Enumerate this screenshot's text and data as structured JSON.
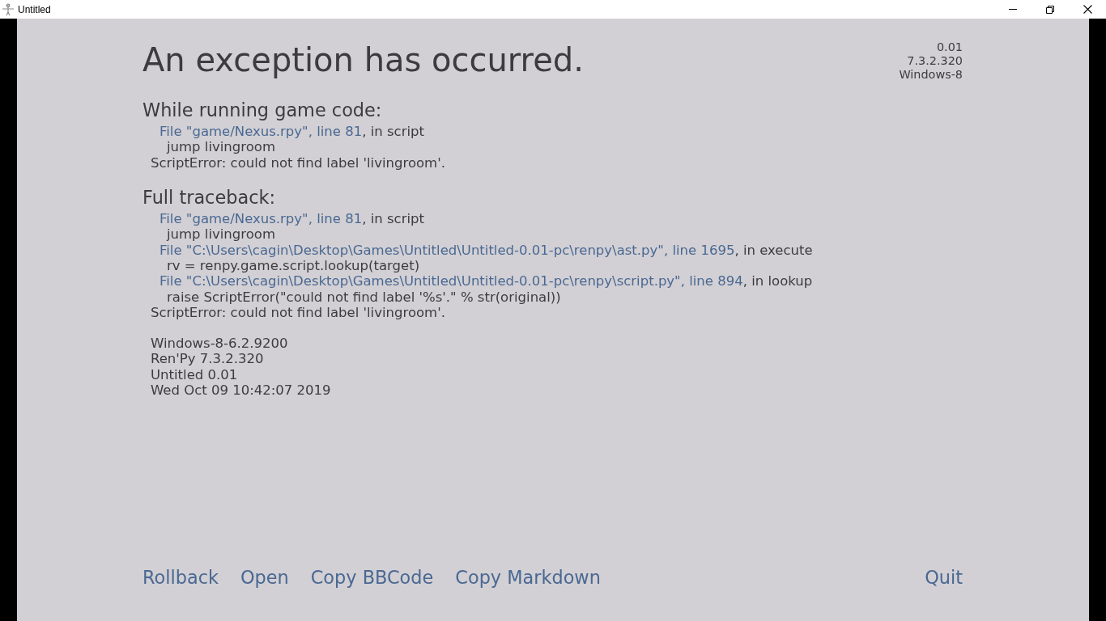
{
  "window": {
    "title": "Untitled"
  },
  "heading": "An exception has occurred.",
  "version_info": [
    "0.01",
    "7.3.2.320",
    "Windows-8"
  ],
  "sections": [
    {
      "title": "While running game code:",
      "lines": [
        {
          "kind": "file",
          "link": "File \"game/Nexus.rpy\", line 81",
          "suffix": ", in script"
        },
        {
          "kind": "code",
          "text": "jump livingroom"
        },
        {
          "kind": "error",
          "text": "ScriptError: could not find label 'livingroom'."
        }
      ]
    },
    {
      "title": "Full traceback:",
      "lines": [
        {
          "kind": "file",
          "link": "File \"game/Nexus.rpy\", line 81",
          "suffix": ", in script"
        },
        {
          "kind": "code",
          "text": "jump livingroom"
        },
        {
          "kind": "file",
          "link": "File \"C:\\Users\\cagin\\Desktop\\Games\\Untitled\\Untitled-0.01-pc\\renpy\\ast.py\", line 1695",
          "suffix": ", in execute"
        },
        {
          "kind": "code",
          "text": "rv = renpy.game.script.lookup(target)"
        },
        {
          "kind": "file",
          "link": "File \"C:\\Users\\cagin\\Desktop\\Games\\Untitled\\Untitled-0.01-pc\\renpy\\script.py\", line 894",
          "suffix": ", in lookup"
        },
        {
          "kind": "code",
          "text": "raise ScriptError(\"could not find label '%s'.\" % str(original))"
        },
        {
          "kind": "error",
          "text": "ScriptError: could not find label 'livingroom'."
        }
      ]
    }
  ],
  "system_info": [
    "Windows-8-6.2.9200",
    "Ren'Py 7.3.2.320",
    "Untitled 0.01",
    "Wed Oct 09 10:42:07 2019"
  ],
  "left_actions": [
    "Rollback",
    "Open",
    "Copy BBCode",
    "Copy Markdown"
  ],
  "right_actions": [
    "Quit"
  ]
}
